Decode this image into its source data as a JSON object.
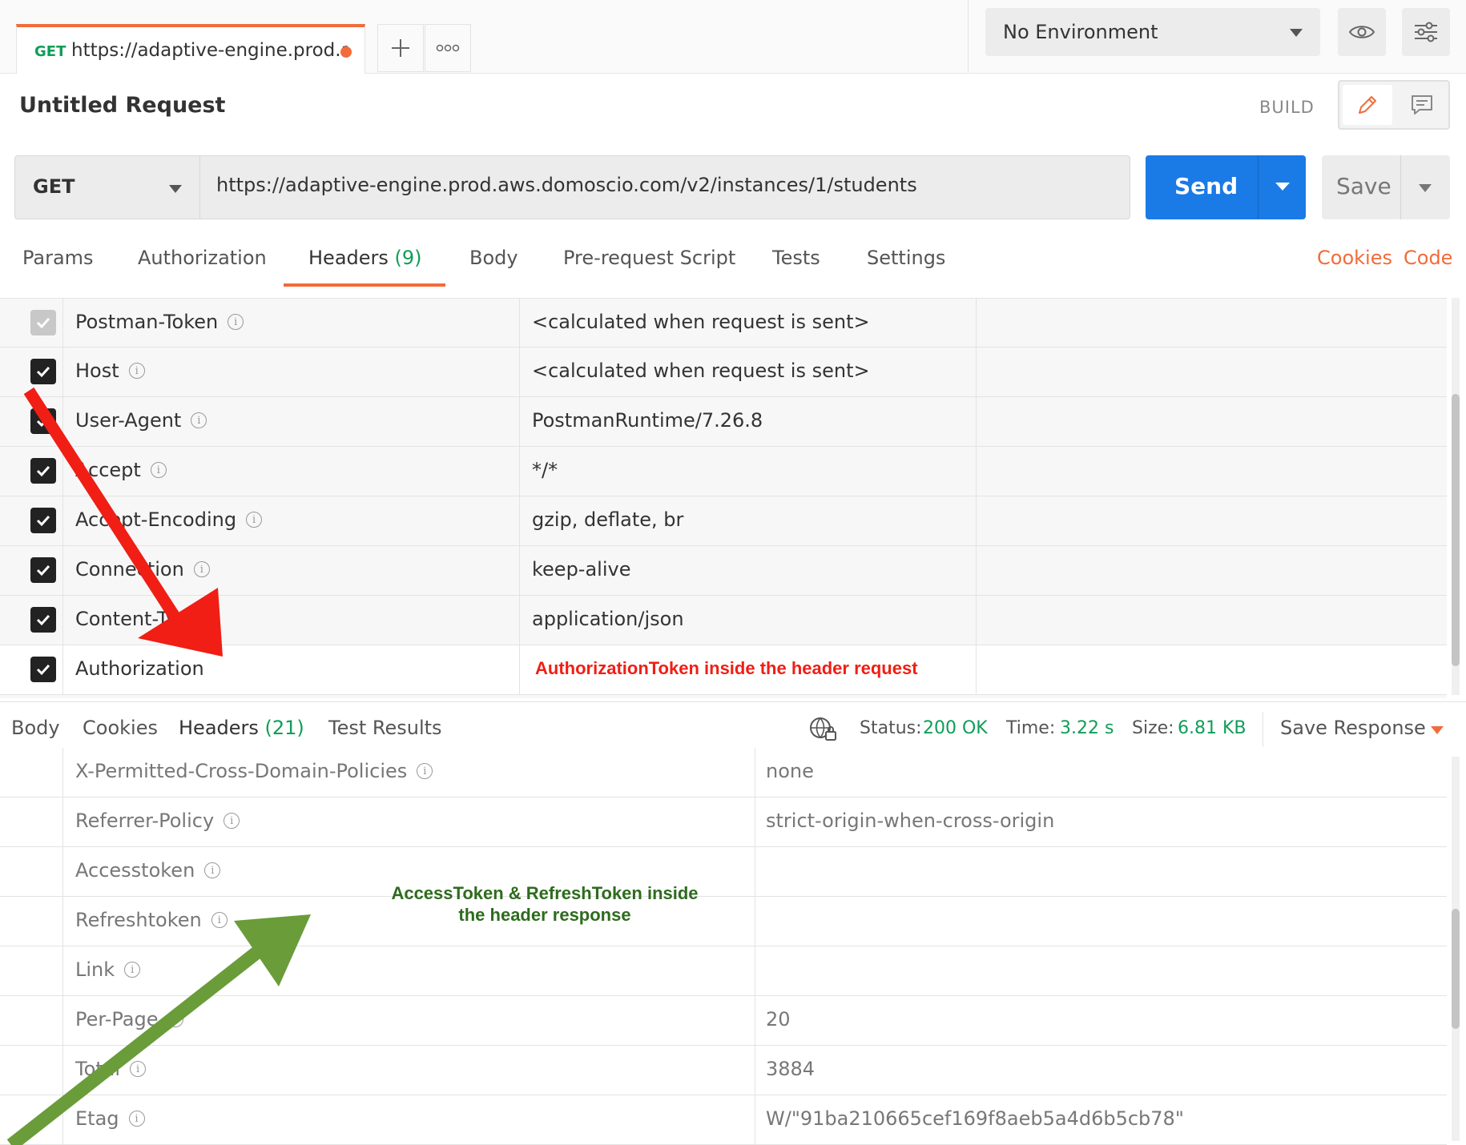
{
  "tab": {
    "method": "GET",
    "url": "https://adaptive-engine.prod.a..."
  },
  "environment": {
    "selected": "No Environment"
  },
  "request": {
    "title": "Untitled Request",
    "build_label": "BUILD",
    "method": "GET",
    "url": "https://adaptive-engine.prod.aws.domoscio.com/v2/instances/1/students",
    "send_label": "Send",
    "save_label": "Save"
  },
  "request_tabs": [
    {
      "label": "Params"
    },
    {
      "label": "Authorization"
    },
    {
      "label": "Headers",
      "count": "(9)"
    },
    {
      "label": "Body"
    },
    {
      "label": "Pre-request Script"
    },
    {
      "label": "Tests"
    },
    {
      "label": "Settings"
    }
  ],
  "request_links": {
    "cookies": "Cookies",
    "code": "Code"
  },
  "request_headers": [
    {
      "key": "Postman-Token",
      "value": "<calculated when request is sent>",
      "checked": "disabled"
    },
    {
      "key": "Host",
      "value": "<calculated when request is sent>",
      "checked": true
    },
    {
      "key": "User-Agent",
      "value": "PostmanRuntime/7.26.8",
      "checked": true
    },
    {
      "key": "Accept",
      "value": "*/*",
      "checked": true
    },
    {
      "key": "Accept-Encoding",
      "value": "gzip, deflate, br",
      "checked": true
    },
    {
      "key": "Connection",
      "value": "keep-alive",
      "checked": true
    },
    {
      "key": "Content-Type",
      "value": "application/json",
      "checked": true
    },
    {
      "key": "Authorization",
      "value": "",
      "checked": true
    }
  ],
  "annotations": {
    "request": "AuthorizationToken inside the header request",
    "response_line1": "AccessToken & RefreshToken inside",
    "response_line2": "the header response"
  },
  "response_tabs": [
    {
      "label": "Body"
    },
    {
      "label": "Cookies"
    },
    {
      "label": "Headers",
      "count": "(21)"
    },
    {
      "label": "Test Results"
    }
  ],
  "response_status": {
    "status_label": "Status:",
    "status_value": "200 OK",
    "time_label": "Time:",
    "time_value": "3.22 s",
    "size_label": "Size:",
    "size_value": "6.81 KB",
    "save_response": "Save Response"
  },
  "response_headers": [
    {
      "key": "X-Permitted-Cross-Domain-Policies",
      "value": "none"
    },
    {
      "key": "Referrer-Policy",
      "value": "strict-origin-when-cross-origin"
    },
    {
      "key": "Accesstoken",
      "value": ""
    },
    {
      "key": "Refreshtoken",
      "value": ""
    },
    {
      "key": "Link",
      "value": ""
    },
    {
      "key": "Per-Page",
      "value": "20"
    },
    {
      "key": "Total",
      "value": "3884"
    },
    {
      "key": "Etag",
      "value": "W/\"91ba210665cef169f8aeb5a4d6b5cb78\""
    }
  ],
  "colors": {
    "accent": "#f26b3a",
    "primary": "#1a7ae6",
    "success": "#0f9d58",
    "arrow_red": "#f01e14",
    "arrow_green": "#6a9c3a"
  },
  "icons": [
    "plus-icon",
    "more-icon",
    "eye-icon",
    "sliders-icon",
    "pencil-icon",
    "comment-icon",
    "globe-lock-icon",
    "info-icon",
    "check-icon"
  ]
}
